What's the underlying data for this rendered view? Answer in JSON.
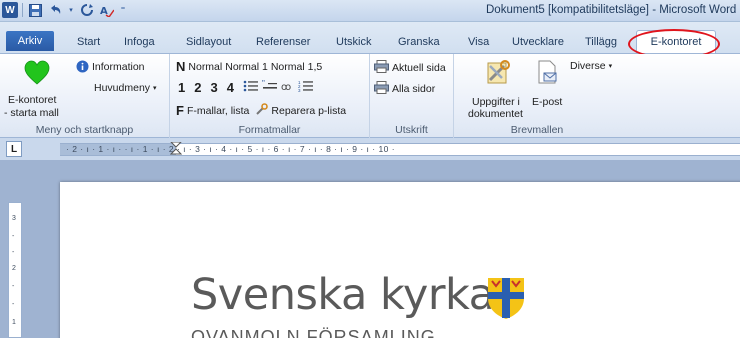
{
  "window": {
    "title": "Dokument5 [kompatibilitetsläge] - Microsoft Word"
  },
  "qat": {
    "app_icon_letter": "W"
  },
  "tabs": [
    {
      "label": "Arkiv"
    },
    {
      "label": "Start"
    },
    {
      "label": "Infoga"
    },
    {
      "label": "Sidlayout"
    },
    {
      "label": "Referenser"
    },
    {
      "label": "Utskick"
    },
    {
      "label": "Granska"
    },
    {
      "label": "Visa"
    },
    {
      "label": "Utvecklare"
    },
    {
      "label": "Tillägg"
    },
    {
      "label": "E-kontoret"
    }
  ],
  "ribbon": {
    "meny": {
      "group_label": "Meny och startknapp",
      "ekontoret_label_1": "E-kontoret",
      "ekontoret_label_2": "- starta mall",
      "information_label": "Information",
      "huvudmeny_label": "Huvudmeny",
      "heart_color": "#22c41c"
    },
    "format": {
      "group_label": "Formatmallar",
      "n_letter": "N",
      "normal": "Normal",
      "normal1": "Normal 1",
      "normal15": "Normal 1,5",
      "h1": "1",
      "h2": "2",
      "h3": "3",
      "h4": "4",
      "f_letter": "F",
      "fmallar": "F-mallar, lista",
      "reparera": "Reparera p-lista"
    },
    "utskrift": {
      "group_label": "Utskrift",
      "aktuell": "Aktuell sida",
      "alla": "Alla sidor"
    },
    "brevmallen": {
      "group_label": "Brevmallen",
      "uppgifter_1": "Uppgifter i",
      "uppgifter_2": "dokumentet",
      "epost": "E-post",
      "diverse": "Diverse"
    }
  },
  "ruler": {
    "button_label": "L",
    "ticks": "· 2 · ı · 1 · ı ·   · ı · 1 · ı · 2 · ı · 3 · ı · 4 · ı · 5 · ı · 6 · ı · 7 · ı · 8 · ı · 9 · ı · 10 ·"
  },
  "document": {
    "logo_text": "Svenska kyrkan",
    "subtitle": "OVANMOLN FÖRSAMLING",
    "crest_color_blue": "#2a5fb0",
    "crest_color_yellow": "#f4c316"
  }
}
